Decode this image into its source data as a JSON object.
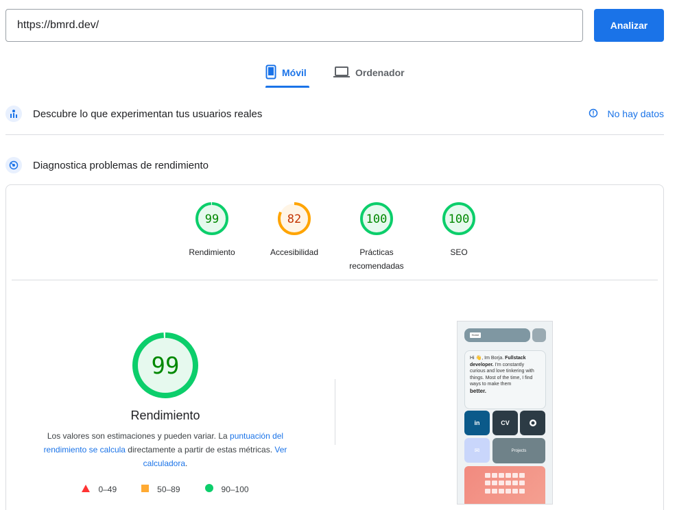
{
  "search": {
    "url": "https://bmrd.dev/",
    "button_label": "Analizar"
  },
  "tabs": [
    {
      "label": "Móvil",
      "icon": "smartphone-icon",
      "active": true
    },
    {
      "label": "Ordenador",
      "icon": "laptop-icon",
      "active": false
    }
  ],
  "field_data": {
    "title": "Descubre lo que experimentan tus usuarios reales",
    "status": "No hay datos",
    "status_icon": "info-icon"
  },
  "lab": {
    "title": "Diagnostica problemas de rendimiento"
  },
  "scores": [
    {
      "value": "99",
      "label": "Rendimiento",
      "level": 0.99,
      "color": "#0cce6b",
      "text_color": "#008800",
      "fill": "#e6f9ee"
    },
    {
      "value": "82",
      "label": "Accesibilidad",
      "level": 0.82,
      "color": "#ffa400",
      "text_color": "#c33300",
      "fill": "#fff5e6"
    },
    {
      "value": "100",
      "label_line1": "Prácticas",
      "label_line2": "recomendadas",
      "level": 1.0,
      "color": "#0cce6b",
      "text_color": "#008800",
      "fill": "#e6f9ee"
    },
    {
      "value": "100",
      "label": "SEO",
      "level": 1.0,
      "color": "#0cce6b",
      "text_color": "#008800",
      "fill": "#e6f9ee"
    }
  ],
  "performance": {
    "score": "99",
    "title": "Rendimiento",
    "desc_part1": "Los valores son estimaciones y pueden variar. La ",
    "desc_link1": "puntuación del rendimiento se calcula",
    "desc_part2": " directamente a partir de estas métricas. ",
    "desc_link2": "Ver calculadora",
    "desc_part3": "."
  },
  "legend": [
    {
      "range": "0–49",
      "shape": "triangle",
      "color": "#ff3333"
    },
    {
      "range": "50–89",
      "shape": "square",
      "color": "#ffaa33"
    },
    {
      "range": "90–100",
      "shape": "circle",
      "color": "#0cce6b"
    }
  ],
  "screenshot": {
    "intro_prefix": "Hi 👋, Im Borja. ",
    "intro_bold": "Fullstack developer.",
    "intro_body": " I'm constantly curious and love tinkering with things. Most of the time, I find ways to make them",
    "intro_end": "better.",
    "tiles": [
      "in",
      "CV",
      "",
      "✉"
    ],
    "projects_label": "Projects"
  }
}
